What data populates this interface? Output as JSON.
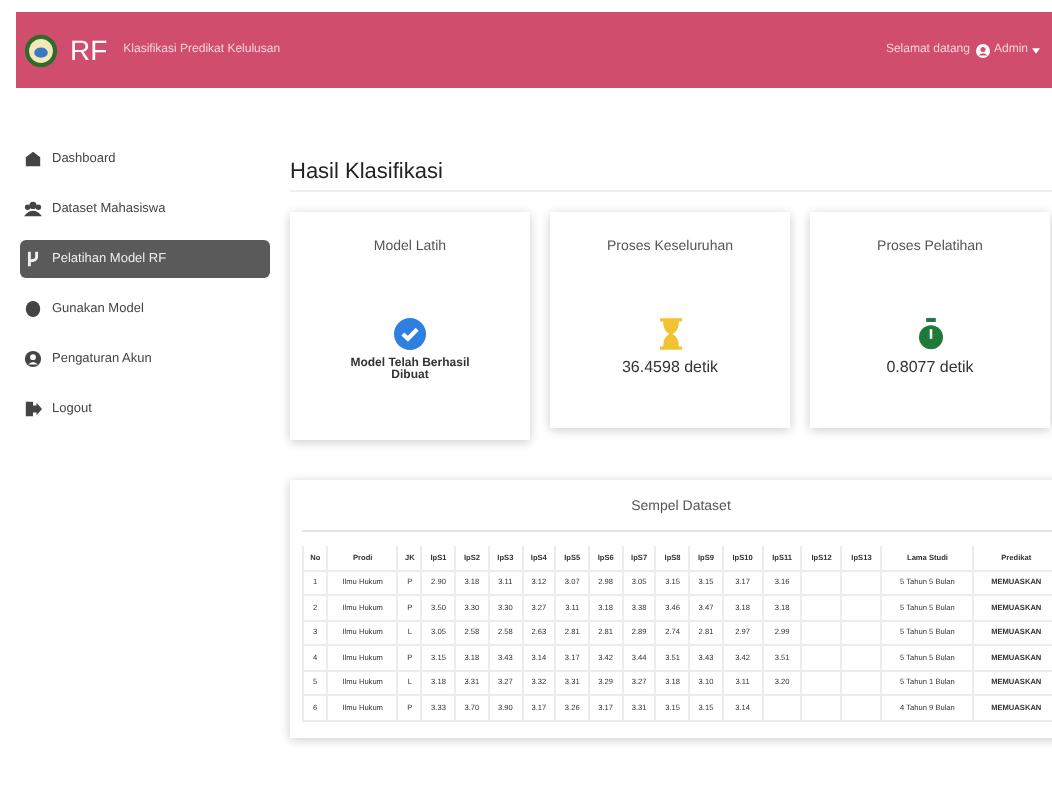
{
  "navbar": {
    "brand": "RF",
    "subtitle": "Klasifikasi Predikat Kelulusan",
    "greeting": "Selamat datang",
    "user": "Admin"
  },
  "sidebar": {
    "items": [
      {
        "label": "Dashboard",
        "selected": false
      },
      {
        "label": "Dataset Mahasiswa",
        "selected": false
      },
      {
        "label": "Pelatihan Model RF",
        "selected": true
      },
      {
        "label": "Gunakan Model",
        "selected": false
      },
      {
        "label": "Pengaturan Akun",
        "selected": false
      },
      {
        "label": "Logout",
        "selected": false
      }
    ]
  },
  "page_title": "Hasil Klasifikasi",
  "cards": [
    {
      "title": "Model Latih",
      "kind": "status",
      "value": "Model Telah Berhasil Dibuat"
    },
    {
      "title": "Proses Keseluruhan",
      "kind": "total-time",
      "value": "36.4598 detik"
    },
    {
      "title": "Proses Pelatihan",
      "kind": "train-time",
      "value": "0.8077 detik"
    }
  ],
  "table": {
    "title": "Sempel Dataset",
    "columns": [
      "No",
      "Prodi",
      "JK",
      "IpS1",
      "IpS2",
      "IpS3",
      "IpS4",
      "IpS5",
      "IpS6",
      "IpS7",
      "IpS8",
      "IpS9",
      "IpS10",
      "IpS11",
      "IpS12",
      "IpS13",
      "Lama Studi",
      "Predikat"
    ],
    "rows": [
      [
        "1",
        "Ilmu Hukum",
        "P",
        "2.90",
        "3.18",
        "3.11",
        "3.12",
        "3.07",
        "2.98",
        "3.05",
        "3.15",
        "3.15",
        "3.17",
        "3.16",
        "",
        "",
        "5 Tahun 5 Bulan",
        "MEMUASKAN"
      ],
      [
        "2",
        "Ilmu Hukum",
        "P",
        "3.50",
        "3.30",
        "3.30",
        "3.27",
        "3.11",
        "3.18",
        "3.38",
        "3.46",
        "3.47",
        "3.18",
        "3.18",
        "",
        "",
        "5 Tahun 5 Bulan",
        "MEMUASKAN"
      ],
      [
        "3",
        "Ilmu Hukum",
        "L",
        "3.05",
        "2.58",
        "2.58",
        "2.63",
        "2.81",
        "2.81",
        "2.89",
        "2.74",
        "2.81",
        "2.97",
        "2.99",
        "",
        "",
        "5 Tahun 5 Bulan",
        "MEMUASKAN"
      ],
      [
        "4",
        "Ilmu Hukum",
        "P",
        "3.15",
        "3.18",
        "3.43",
        "3.14",
        "3.17",
        "3.42",
        "3.44",
        "3.51",
        "3.43",
        "3.42",
        "3.51",
        "",
        "",
        "5 Tahun 5 Bulan",
        "MEMUASKAN"
      ],
      [
        "5",
        "Ilmu Hukum",
        "L",
        "3.18",
        "3.31",
        "3.27",
        "3.32",
        "3.31",
        "3.29",
        "3.27",
        "3.18",
        "3.10",
        "3.11",
        "3.20",
        "",
        "",
        "5 Tahun 1 Bulan",
        "MEMUASKAN"
      ],
      [
        "6",
        "Ilmu Hukum",
        "P",
        "3.33",
        "3.70",
        "3.90",
        "3.17",
        "3.26",
        "3.17",
        "3.31",
        "3.15",
        "3.15",
        "3.14",
        "",
        "",
        "",
        "4 Tahun 9 Bulan",
        "MEMUASKAN"
      ]
    ]
  }
}
